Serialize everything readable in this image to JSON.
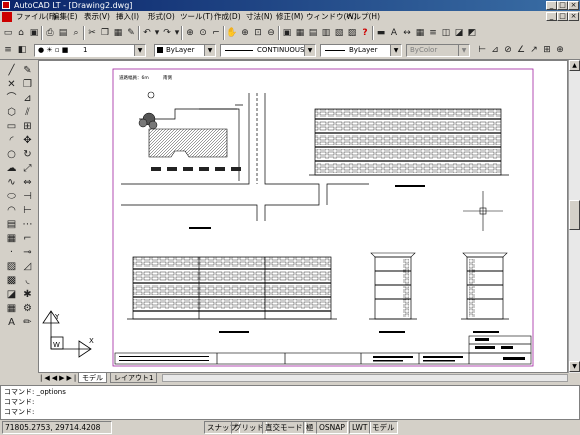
{
  "window": {
    "title": "AutoCAD LT - [Drawing2.dwg]"
  },
  "menu": {
    "items": [
      "ファイル(F)",
      "編集(E)",
      "表示(V)",
      "挿入(I)",
      "形式(O)",
      "ツール(T)",
      "作成(D)",
      "寸法(N)",
      "修正(M)",
      "ウィンドウ(W)",
      "ヘルプ(H)"
    ]
  },
  "properties": {
    "layer_value": "1",
    "color_value": "ByLayer",
    "linetype_value": "CONTINUOUS",
    "lineweight_value": "ByLayer",
    "plotstyle_value": "ByColor"
  },
  "drawing": {
    "site_label": "道路幅員：6m",
    "site_label2": "南側",
    "tabs": [
      "モデル",
      "レイアウト1"
    ]
  },
  "command": {
    "lines": [
      "コマンド: _options",
      "コマンド:",
      "コマンド:"
    ]
  },
  "status": {
    "coordinates": "71805.2753, 29714.4208",
    "buttons": [
      "スナップ",
      "グリッド",
      "直交モード",
      "極",
      "OSNAP",
      "LWT",
      "モデル"
    ]
  }
}
